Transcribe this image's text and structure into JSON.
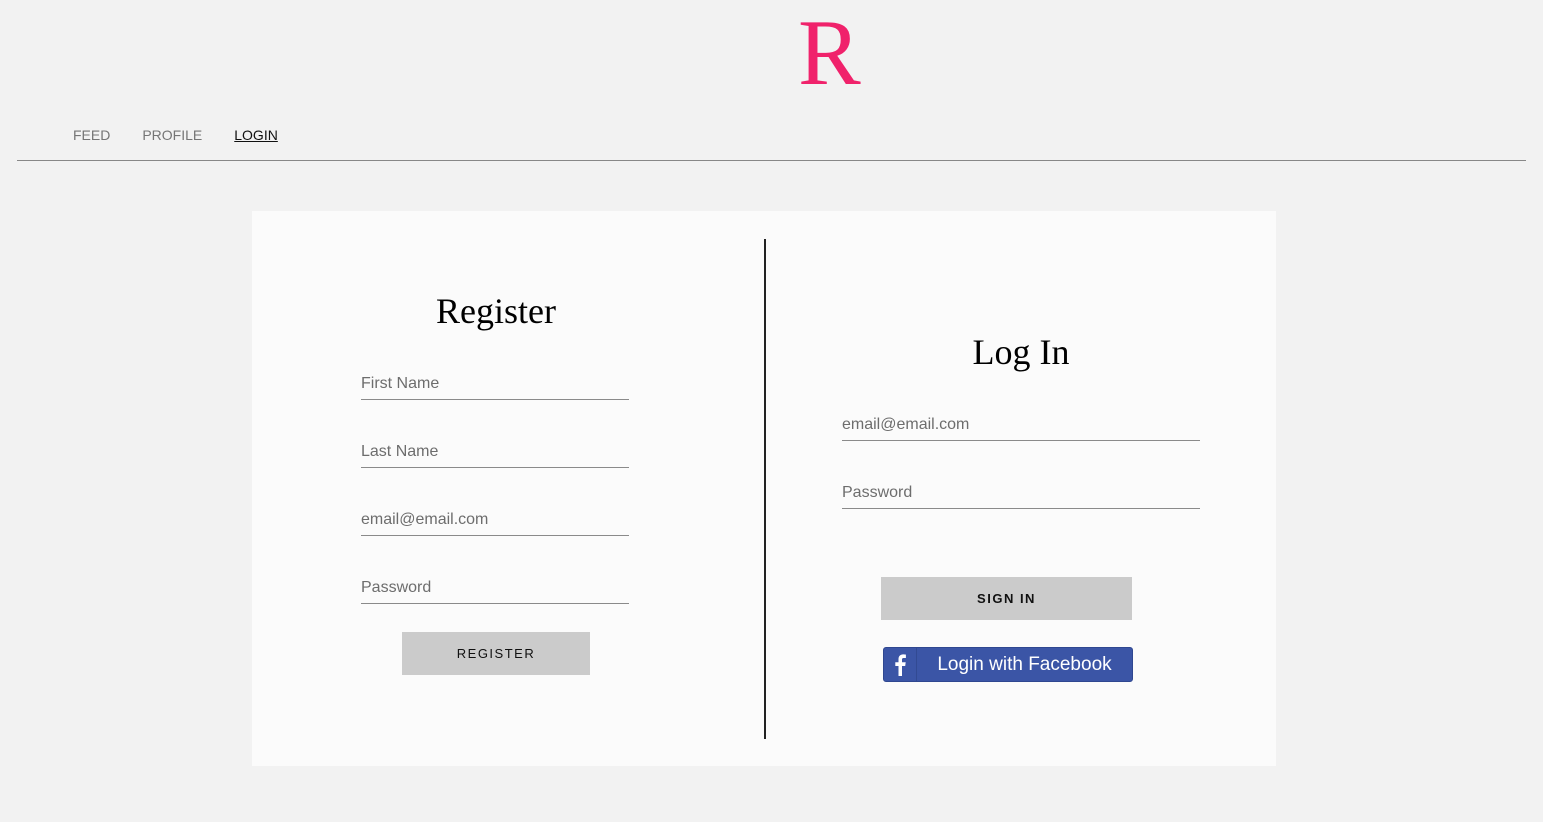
{
  "logo": {
    "text": "R",
    "color": "#f0226b"
  },
  "nav": {
    "items": [
      {
        "label": "FEED"
      },
      {
        "label": "PROFILE"
      },
      {
        "label": "LOGIN"
      }
    ],
    "active": "LOGIN"
  },
  "register": {
    "title": "Register",
    "first_name_placeholder": "First Name",
    "last_name_placeholder": "Last Name",
    "email_placeholder": "email@email.com",
    "password_placeholder": "Password",
    "button_label": "REGISTER"
  },
  "login": {
    "title": "Log In",
    "email_placeholder": "email@email.com",
    "password_placeholder": "Password",
    "button_label": "SIGN IN",
    "facebook_label": "Login with Facebook",
    "facebook_color": "#3b55a6"
  }
}
